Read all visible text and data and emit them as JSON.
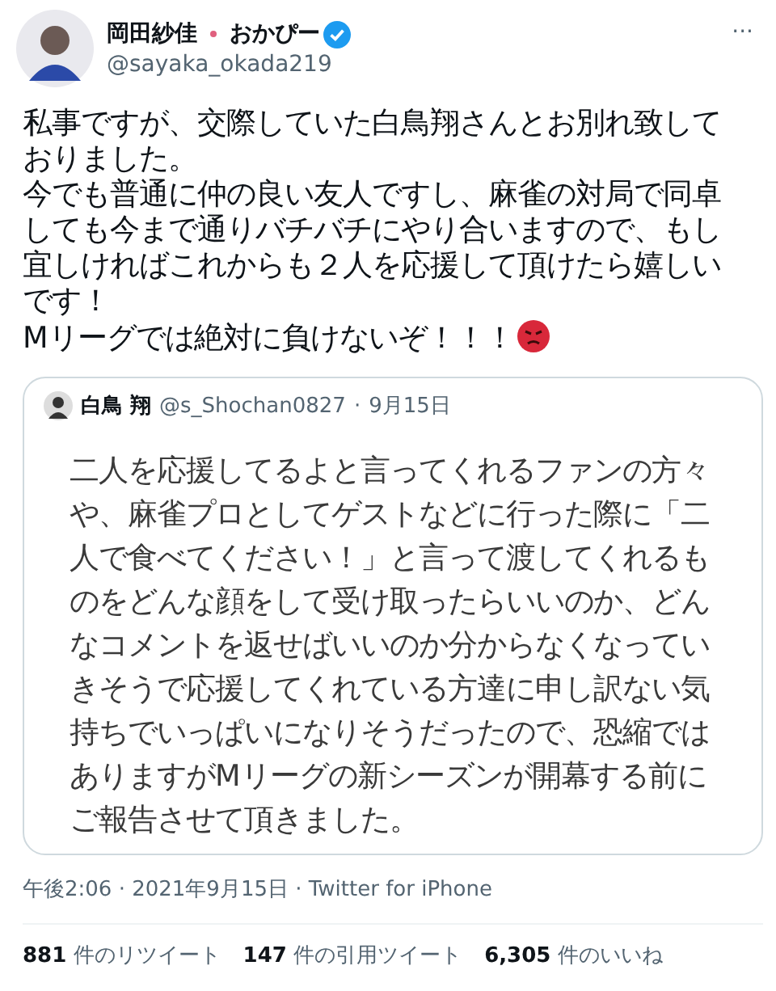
{
  "author": {
    "name_before": "岡田紗佳",
    "name_after": "おかぴー",
    "handle": "@sayaka_okada219",
    "verified": true,
    "menu": "···"
  },
  "tweet_paragraphs": [
    "私事ですが、交際していた白鳥翔さんとお別れ致しておりました。",
    "今でも普通に仲の良い友人ですし、麻雀の対局で同卓しても今まで通りバチバチにやり合いますので、もし宜しければこれからも２人を応援して頂けたら嬉しいです！",
    "Mリーグでは絶対に負けないぞ！！！"
  ],
  "quote": {
    "name": "白鳥 翔",
    "handle": "@s_Shochan0827",
    "date": "9月15日",
    "separator": "·",
    "text": "二人を応援してるよと言ってくれるファンの方々や、麻雀プロとしてゲストなどに行った際に「二人で食べてください！」と言って渡してくれるものをどんな顔をして受け取ったらいいのか、どんなコメントを返せばいいのか分からなくなっていきそうで応援してくれている方達に申し訳ない気持ちでいっぱいになりそうだったので、恐縮ではありますがMリーグの新シーズンが開幕する前にご報告させて頂きました。"
  },
  "timestamp": "午後2:06 · 2021年9月15日 · Twitter for iPhone",
  "stats": [
    {
      "count": "881",
      "label": "件のリツイート"
    },
    {
      "count": "147",
      "label": "件の引用ツイート"
    },
    {
      "count": "6,305",
      "label": "件のいいね"
    }
  ]
}
